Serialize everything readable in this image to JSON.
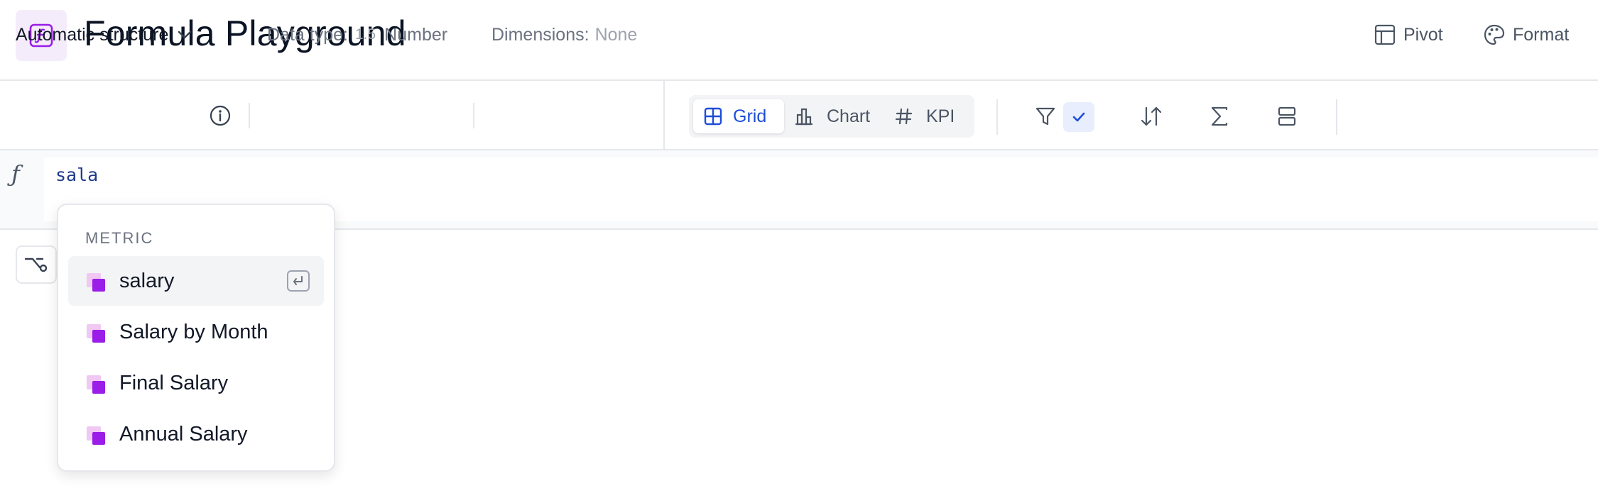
{
  "header": {
    "app_icon": "function-icon",
    "title": "Formula Playground"
  },
  "toolbar": {
    "structure_label": "Automatic structure",
    "data_type_label": "Data type:",
    "data_type_icon_text": "1.5",
    "data_type_value": "Number",
    "dimensions_label": "Dimensions:",
    "dimensions_value": "None",
    "views": [
      {
        "label": "Grid",
        "icon": "grid-icon",
        "active": true
      },
      {
        "label": "Chart",
        "icon": "bar-chart-icon",
        "active": false
      },
      {
        "label": "KPI",
        "icon": "hash-icon",
        "active": false
      }
    ],
    "pivot_label": "Pivot",
    "format_label": "Format"
  },
  "formula": {
    "fx_symbol": "ƒ",
    "text": "sala"
  },
  "autocomplete": {
    "header": "METRIC",
    "items": [
      {
        "label": "salary",
        "selected": true
      },
      {
        "label": "Salary by Month",
        "selected": false
      },
      {
        "label": "Final Salary",
        "selected": false
      },
      {
        "label": "Annual Salary",
        "selected": false
      }
    ]
  },
  "colors": {
    "accent_blue": "#1d4ed8",
    "metric_purple": "#9a1de8",
    "metric_pink": "#f0c8f3"
  }
}
